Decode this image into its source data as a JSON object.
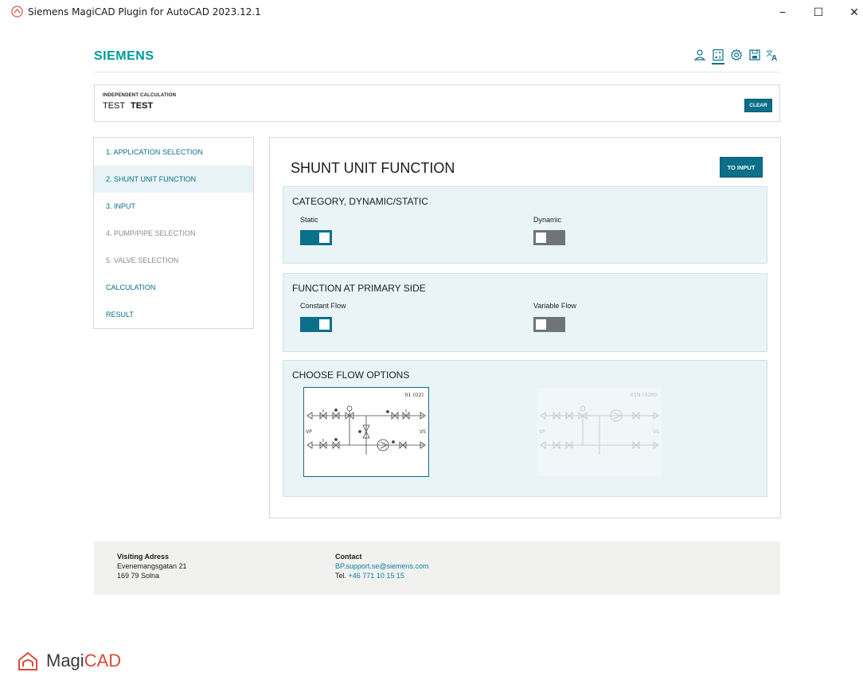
{
  "window": {
    "title": "Siemens MagiCAD Plugin for AutoCAD 2023.12.1",
    "minimize": "−",
    "maximize": "☐",
    "close": "✕"
  },
  "header": {
    "brand": "SIEMENS",
    "icons": [
      "user-icon",
      "calculator-icon",
      "settings-icon",
      "save-icon",
      "translate-icon"
    ],
    "active_icon": "calculator-icon"
  },
  "calculation": {
    "label": "INDEPENDENT CALCULATION",
    "name_part1": "TEST",
    "name_part2": "TEST",
    "clear_label": "CLEAR"
  },
  "sidebar": {
    "items": [
      {
        "label": "1. APPLICATION SELECTION",
        "state": "done"
      },
      {
        "label": "2. SHUNT UNIT FUNCTION",
        "state": "current"
      },
      {
        "label": "3. INPUT",
        "state": "done"
      },
      {
        "label": "4. PUMP/PIPE SELECTION",
        "state": "disabled"
      },
      {
        "label": "5. VALVE SELECTION",
        "state": "disabled"
      },
      {
        "label": "CALCULATION",
        "state": "done"
      },
      {
        "label": "RESULT",
        "state": "done"
      }
    ]
  },
  "main": {
    "title": "SHUNT UNIT FUNCTION",
    "to_input_label": "TO INPUT",
    "sections": {
      "category": {
        "title": "CATEGORY, DYNAMIC/STATIC",
        "option_a": {
          "label": "Static",
          "on": true
        },
        "option_b": {
          "label": "Dynamic",
          "on": false
        }
      },
      "primary": {
        "title": "FUNCTION AT PRIMARY SIDE",
        "option_a": {
          "label": "Constant Flow",
          "on": true
        },
        "option_b": {
          "label": "Variable Flow",
          "on": false
        }
      },
      "flow": {
        "title": "CHOOSE FLOW OPTIONS",
        "cards": [
          {
            "code": "01 (02)",
            "selected": true,
            "vp": "VP",
            "vs": "VS"
          },
          {
            "code": "01N (02N)",
            "selected": false,
            "vp": "VP",
            "vs": "VS"
          }
        ]
      }
    }
  },
  "footer": {
    "visit_head": "Visiting Adress",
    "visit_line1": "Evenemangsgatan 21",
    "visit_line2": "169 79 Solna",
    "contact_head": "Contact",
    "contact_email": "BP.support.se@siemens.com",
    "contact_tel_label": "Tel.",
    "contact_tel": "+46 771 10 15 15"
  },
  "logo": {
    "text_main": "Magi",
    "text_accent": "CAD"
  },
  "colors": {
    "brand": "#009999",
    "accent": "#0a6f88",
    "section_bg": "#eaf4f6",
    "toggle_off": "#6f7478",
    "footer_bg": "#f1f1ef"
  }
}
